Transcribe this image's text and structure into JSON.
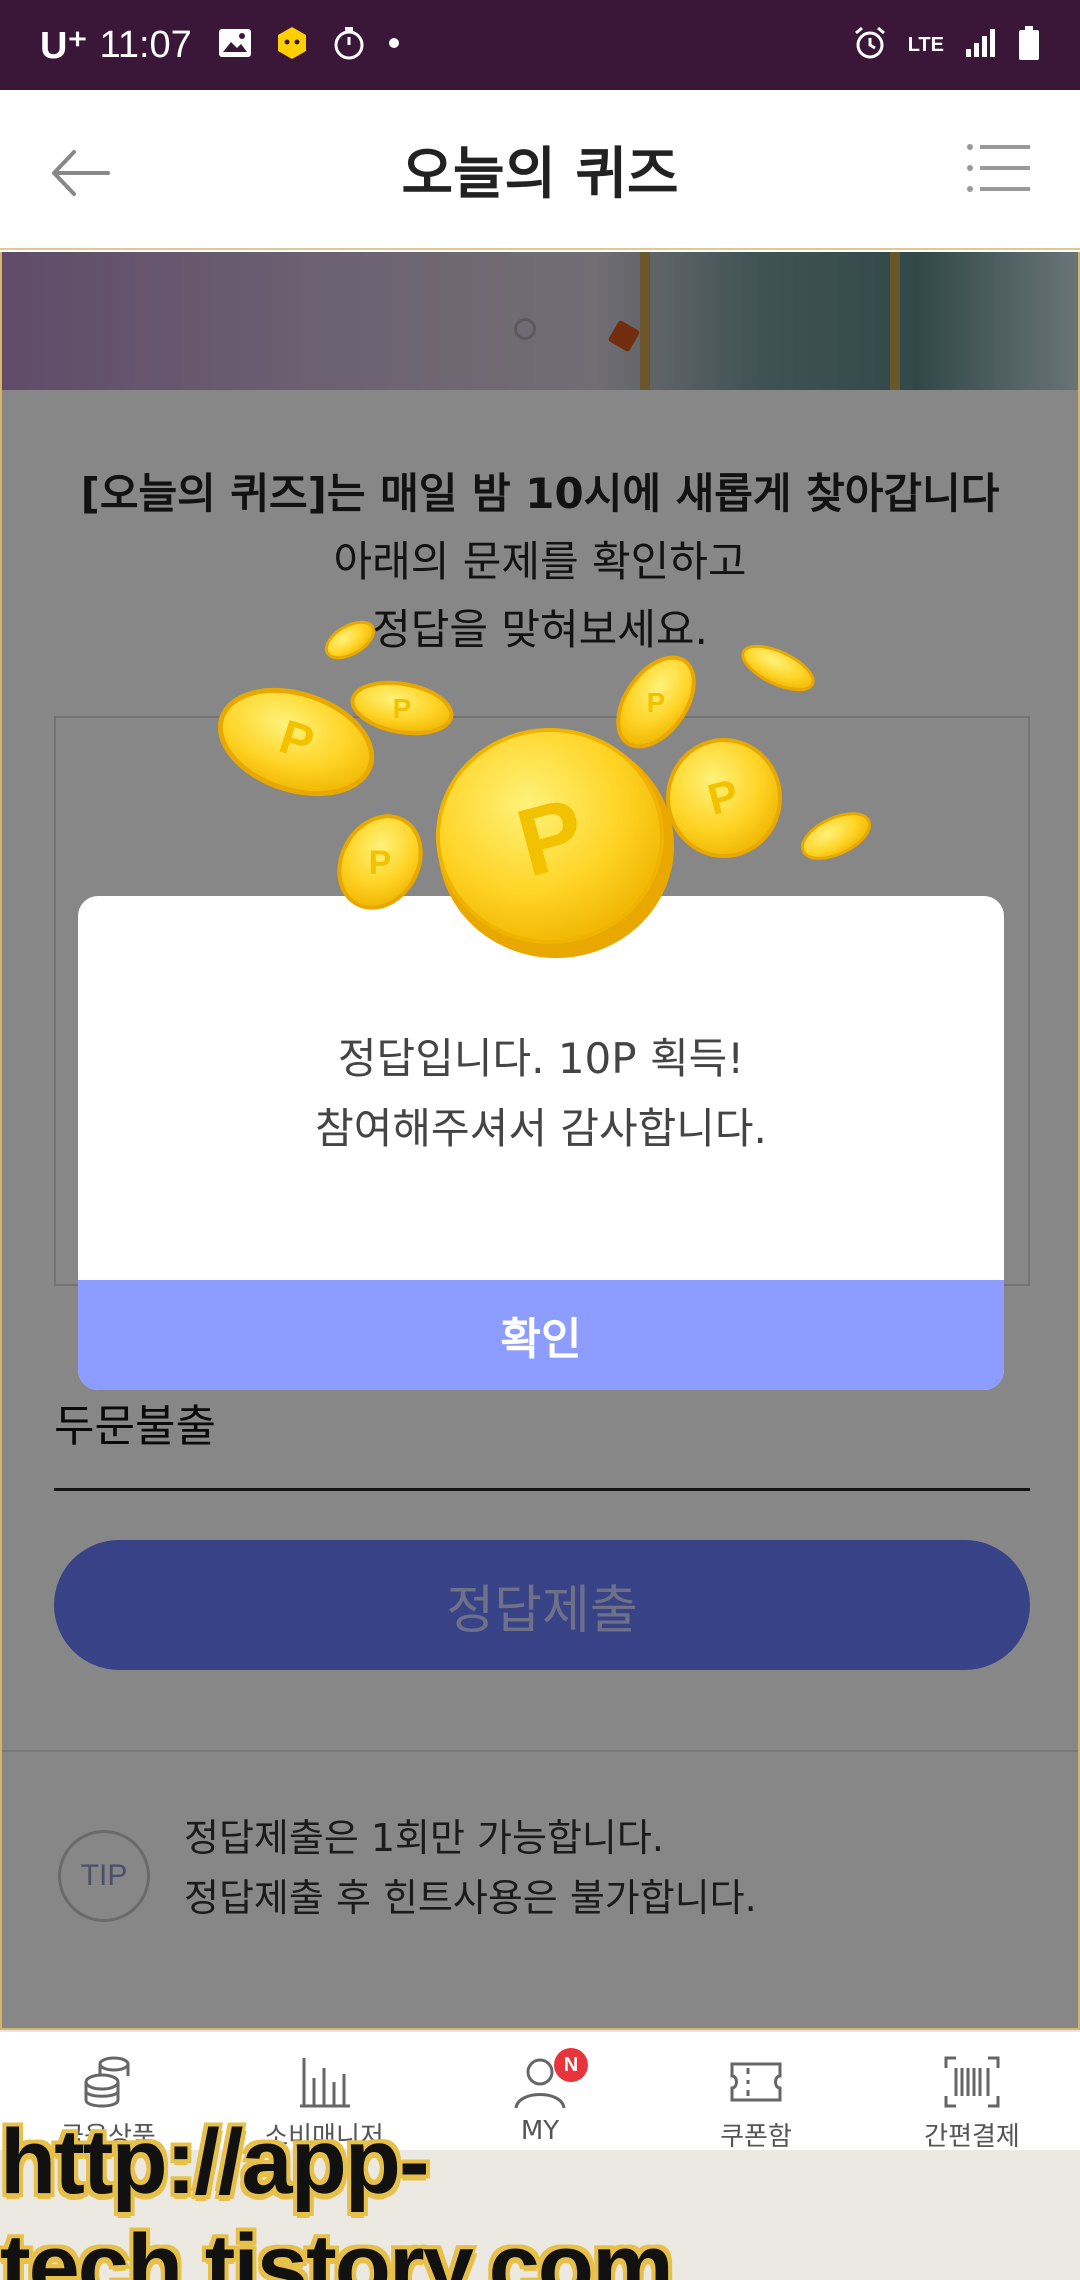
{
  "status_bar": {
    "carrier": "U⁺",
    "time": "11:07",
    "network": "LTE"
  },
  "header": {
    "title": "오늘의 퀴즈"
  },
  "intro": {
    "line1": "[오늘의 퀴즈]는 매일 밤 10시에 새롭게 찾아갑니다",
    "line2": "아래의 문제를 확인하고",
    "line3": "정답을 맞혀보세요."
  },
  "answer_input": {
    "value": "두문불출"
  },
  "submit_button": {
    "label": "정답제출"
  },
  "tip": {
    "badge": "TIP",
    "line1": "정답제출은 1회만 가능합니다.",
    "line2": "정답제출 후 힌트사용은 불가합니다."
  },
  "dialog": {
    "line1": "정답입니다. 10P 획득!",
    "line2": "참여해주셔서 감사합니다.",
    "confirm_label": "확인",
    "coin_letter": "P"
  },
  "bottom_nav": {
    "items": [
      {
        "label": "금융상품",
        "icon": "coins-icon"
      },
      {
        "label": "소비매니저",
        "icon": "bar-chart-icon"
      },
      {
        "label": "MY",
        "icon": "user-icon",
        "badge": "N"
      },
      {
        "label": "쿠폰함",
        "icon": "ticket-icon"
      },
      {
        "label": "간편결제",
        "icon": "barcode-icon"
      }
    ]
  },
  "watermark": {
    "text": "http://app-tech.tistory.com"
  },
  "colors": {
    "status_bar": "#3a1638",
    "primary": "#6b7dff",
    "dialog_button": "#8c9cff",
    "coin": "#ffd426",
    "badge": "#e8353c"
  }
}
